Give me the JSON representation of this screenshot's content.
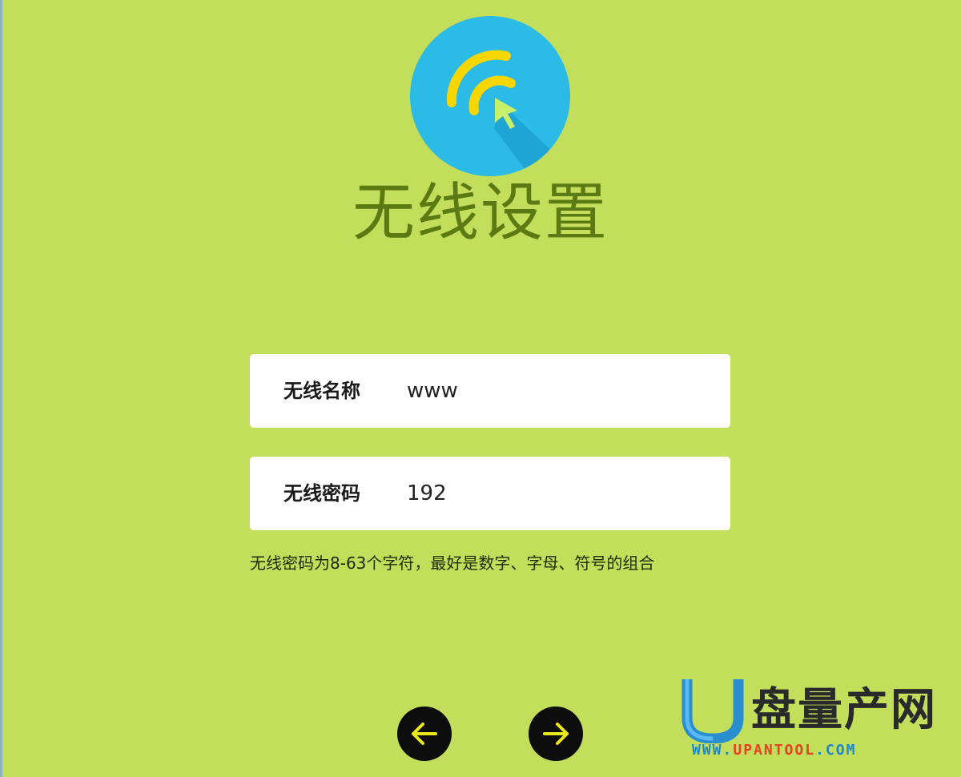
{
  "page": {
    "title": "无线设置"
  },
  "form": {
    "ssid": {
      "label": "无线名称",
      "value": "www"
    },
    "password": {
      "label": "无线密码",
      "value": "192"
    },
    "hint": "无线密码为8-63个字符，最好是数字、字母、符号的组合"
  },
  "nav": {
    "prev_icon": "arrow-left-icon",
    "next_icon": "arrow-right-icon"
  },
  "watermark": {
    "brand": "盘量产网",
    "url_part1": "WWW.",
    "url_part2": "UPANTOOL",
    "url_part3": ".COM"
  },
  "colors": {
    "background": "#c2de5a",
    "title": "#5c7a14",
    "logo_circle": "#2bbbe6",
    "logo_arc": "#f5d600",
    "nav_button": "#0d0d0d",
    "nav_arrow": "#e8e81a"
  }
}
